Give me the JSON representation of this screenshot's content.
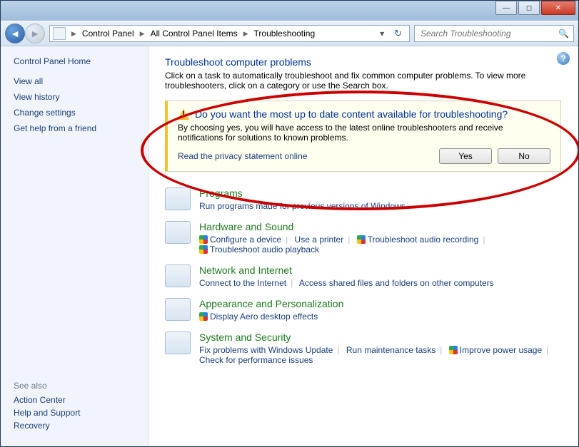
{
  "breadcrumb": {
    "root": "Control Panel",
    "mid": "All Control Panel Items",
    "leaf": "Troubleshooting"
  },
  "search": {
    "placeholder": "Search Troubleshooting"
  },
  "sidebar": {
    "home": "Control Panel Home",
    "links": [
      "View all",
      "View history",
      "Change settings",
      "Get help from a friend"
    ],
    "seeAlsoTitle": "See also",
    "seeAlso": [
      "Action Center",
      "Help and Support",
      "Recovery"
    ]
  },
  "main": {
    "title": "Troubleshoot computer problems",
    "intro": "Click on a task to automatically troubleshoot and fix common computer problems. To view more troubleshooters, click on a category or use the Search box."
  },
  "banner": {
    "title": "Do you want the most up to date content available for troubleshooting?",
    "body": "By choosing yes, you will have access to the latest online troubleshooters and receive notifications for solutions to known problems.",
    "privacy": "Read the privacy statement online",
    "yes": "Yes",
    "no": "No"
  },
  "cat": {
    "programs": {
      "title": "Programs",
      "l1": "Run programs made for previous versions of Windows"
    },
    "hw": {
      "title": "Hardware and Sound",
      "l1": "Configure a device",
      "l2": "Use a printer",
      "l3": "Troubleshoot audio recording",
      "l4": "Troubleshoot audio playback"
    },
    "net": {
      "title": "Network and Internet",
      "l1": "Connect to the Internet",
      "l2": "Access shared files and folders on other computers"
    },
    "app": {
      "title": "Appearance and Personalization",
      "l1": "Display Aero desktop effects"
    },
    "sys": {
      "title": "System and Security",
      "l1": "Fix problems with Windows Update",
      "l2": "Run maintenance tasks",
      "l3": "Improve power usage",
      "l4": "Check for performance issues"
    }
  }
}
